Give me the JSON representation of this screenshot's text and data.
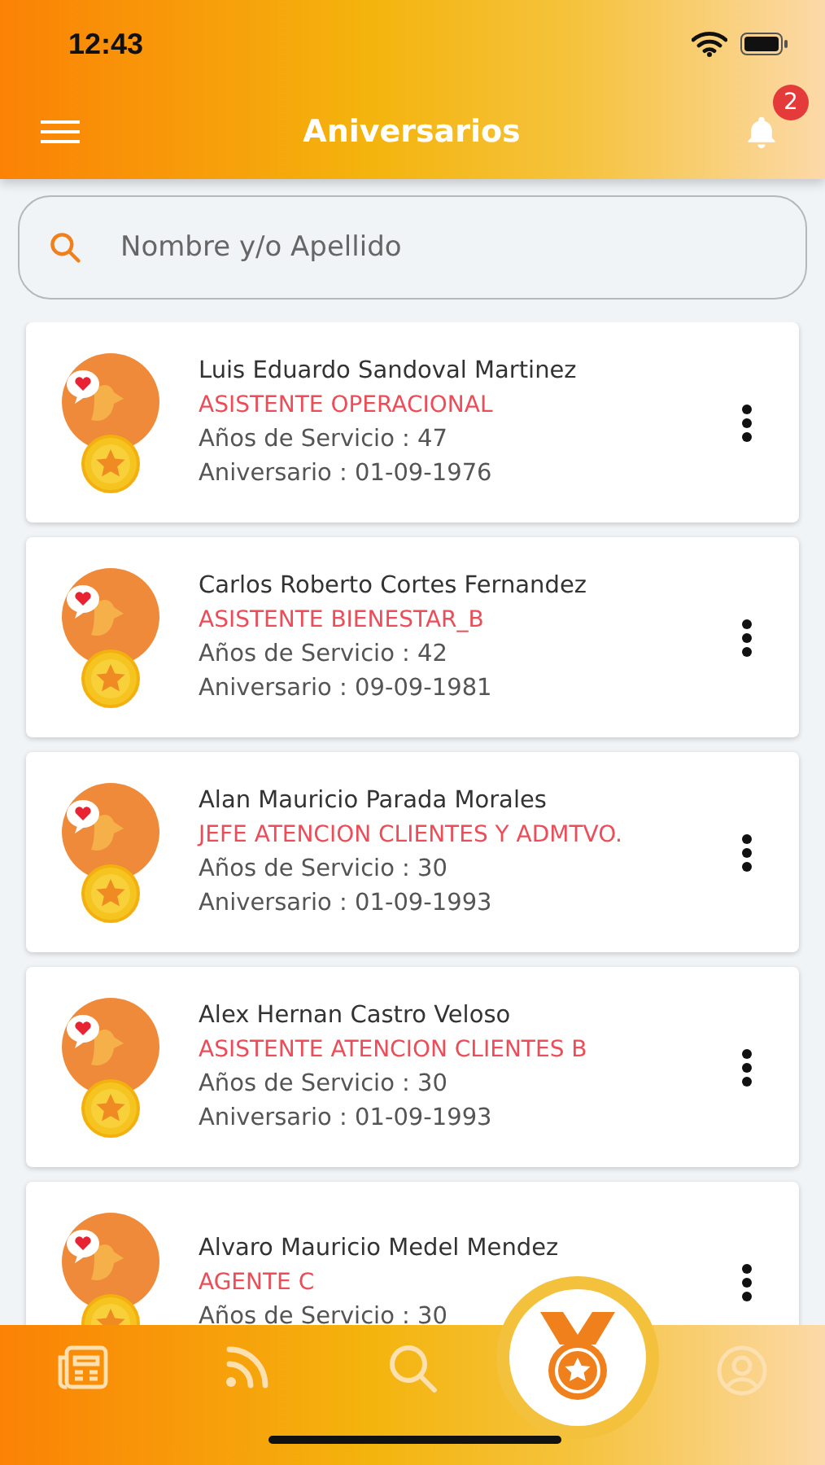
{
  "status_bar": {
    "time": "12:43"
  },
  "header": {
    "title": "Aniversarios",
    "notifications": "2"
  },
  "search": {
    "placeholder": "Nombre y/o Apellido"
  },
  "people": [
    {
      "name": "Luis Eduardo Sandoval Martinez",
      "role": "ASISTENTE OPERACIONAL",
      "years": "Años de Servicio : 47",
      "anniversary": "Aniversario : 01-09-1976"
    },
    {
      "name": "Carlos Roberto Cortes Fernandez",
      "role": "ASISTENTE BIENESTAR_B",
      "years": "Años de Servicio : 42",
      "anniversary": "Aniversario : 09-09-1981"
    },
    {
      "name": "Alan Mauricio Parada Morales",
      "role": "JEFE ATENCION CLIENTES Y ADMTVO.",
      "years": "Años de Servicio : 30",
      "anniversary": "Aniversario : 01-09-1993"
    },
    {
      "name": "Alex Hernan Castro Veloso",
      "role": "ASISTENTE ATENCION CLIENTES B",
      "years": "Años de Servicio : 30",
      "anniversary": "Aniversario : 01-09-1993"
    },
    {
      "name": "Alvaro Mauricio Medel Mendez",
      "role": "AGENTE C",
      "years": "Años de Servicio : 30"
    }
  ],
  "nav": [
    {
      "selected": false
    },
    {
      "selected": false
    },
    {
      "selected": false
    },
    {
      "selected": true
    },
    {
      "selected": false
    }
  ]
}
